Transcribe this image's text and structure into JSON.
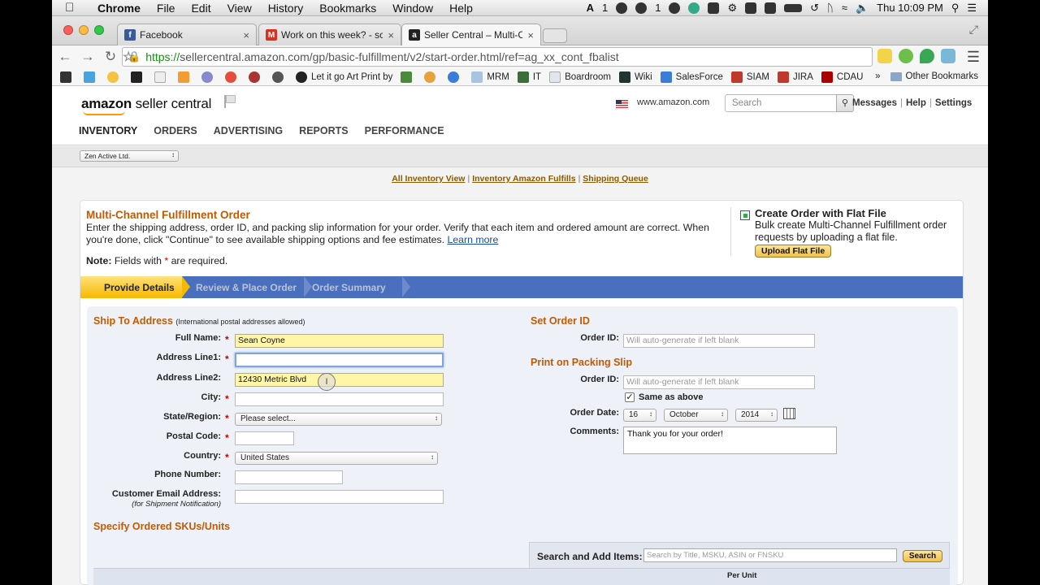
{
  "os_menubar": {
    "app_name": "Chrome",
    "menus": [
      "File",
      "Edit",
      "View",
      "History",
      "Bookmarks",
      "Window",
      "Help"
    ],
    "status_text_1": "1",
    "status_text_2": "1",
    "clock": "Thu 10:09 PM"
  },
  "browser": {
    "tabs": [
      {
        "title": "Facebook",
        "favicon_color": "#3b5998",
        "favicon_letter": "f"
      },
      {
        "title": "Work on this week? - scoy",
        "favicon_color": "#d93025",
        "favicon_letter": "M"
      },
      {
        "title": "Seller Central – Multi-Char",
        "favicon_color": "#222222",
        "favicon_letter": "a"
      }
    ],
    "url_scheme": "https://",
    "url_rest": "sellercentral.amazon.com/gp/basic-fulfillment/v2/start-order.html/ref=ag_xx_cont_fbalist",
    "bookmarks": [
      "Let it go Art Print by",
      "MRM",
      "IT",
      "Boardroom",
      "Wiki",
      "SalesForce",
      "SIAM",
      "JIRA",
      "CDAU"
    ],
    "bookmarks_more": "»",
    "other_bookmarks": "Other Bookmarks"
  },
  "seller_central": {
    "logo_brand": "amazon",
    "logo_product": "seller central",
    "marketplace": "www.amazon.com",
    "search_placeholder": "Search",
    "top_links": [
      "Messages",
      "Help",
      "Settings"
    ],
    "nav": [
      "INVENTORY",
      "ORDERS",
      "ADVERTISING",
      "REPORTS",
      "PERFORMANCE"
    ],
    "merchant_select": "Zen Active Ltd.",
    "inventory_links": [
      "All Inventory View",
      "Inventory Amazon Fulfills",
      "Shipping Queue"
    ]
  },
  "order_panel": {
    "title": "Multi-Channel Fulfillment Order",
    "description": "Enter the shipping address, order ID, and packing slip information for your order. Verify that each item and ordered amount are correct. When you're done, click \"Continue\" to see available shipping options and fee estimates.",
    "learn_more": "Learn more",
    "note_label": "Note:",
    "note_text_before": "Fields with",
    "note_text_after": "are required.",
    "flat_file_title": "Create Order with Flat File",
    "flat_file_text": "Bulk create Multi-Channel Fulfillment order requests by uploading a flat file.",
    "flat_file_button": "Upload Flat File",
    "steps": [
      "Provide Details",
      "Review & Place Order",
      "Order Summary"
    ]
  },
  "ship_to": {
    "title": "Ship To Address",
    "subtitle": "(International postal addresses allowed)",
    "full_name_label": "Full Name:",
    "full_name_value": "Sean Coyne",
    "address1_label": "Address Line1:",
    "address1_value": "",
    "address2_label": "Address Line2:",
    "address2_value": "12430 Metric Blvd",
    "city_label": "City:",
    "state_label": "State/Region:",
    "state_value": "Please select...",
    "postal_label": "Postal Code:",
    "country_label": "Country:",
    "country_value": "United States",
    "phone_label": "Phone Number:",
    "email_label": "Customer Email Address:",
    "email_sublabel": "(for Shipment Notification)"
  },
  "order_id_section": {
    "title": "Set Order ID",
    "order_id_label": "Order ID:",
    "order_id_placeholder": "Will auto-generate if left blank"
  },
  "packing_slip": {
    "title": "Print on Packing Slip",
    "order_id_label": "Order ID:",
    "order_id_placeholder": "Will auto-generate if left blank",
    "same_as_above": "Same as above",
    "same_checked": true,
    "date_label": "Order Date:",
    "day": "16",
    "month": "October",
    "year": "2014",
    "comments_label": "Comments:",
    "comments_value": "Thank you for your order!"
  },
  "skus": {
    "title": "Specify Ordered SKUs/Units",
    "search_label": "Search and Add Items:",
    "search_placeholder": "Search by Title, MSKU, ASIN or FNSKU",
    "search_button": "Search",
    "col_per_unit": "Per Unit"
  }
}
